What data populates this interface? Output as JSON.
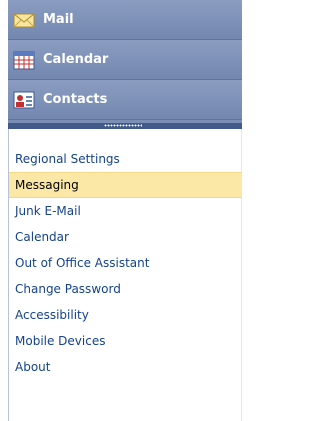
{
  "nav": {
    "buttons": [
      {
        "label": "Mail",
        "icon": "mail-envelope-icon"
      },
      {
        "label": "Calendar",
        "icon": "calendar-grid-icon"
      },
      {
        "label": "Contacts",
        "icon": "contacts-card-icon"
      }
    ]
  },
  "options": {
    "items": [
      {
        "label": "Regional Settings",
        "selected": false
      },
      {
        "label": "Messaging",
        "selected": true
      },
      {
        "label": "Junk E-Mail",
        "selected": false
      },
      {
        "label": "Calendar",
        "selected": false
      },
      {
        "label": "Out of Office Assistant",
        "selected": false
      },
      {
        "label": "Change Password",
        "selected": false
      },
      {
        "label": "Accessibility",
        "selected": false
      },
      {
        "label": "Mobile Devices",
        "selected": false
      },
      {
        "label": "About",
        "selected": false
      }
    ]
  },
  "colors": {
    "nav_bg": "#7b8fb4",
    "link": "#15428b",
    "selected_bg": "#fbe8a6"
  }
}
